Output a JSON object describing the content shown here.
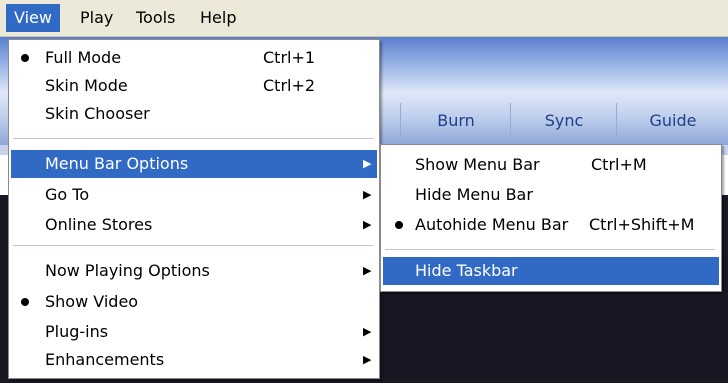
{
  "menubar": {
    "items": [
      {
        "label": "View"
      },
      {
        "label": "Play"
      },
      {
        "label": "Tools"
      },
      {
        "label": "Help"
      }
    ]
  },
  "background_tabs": [
    {
      "label": "Burn"
    },
    {
      "label": "Sync"
    },
    {
      "label": "Guide"
    }
  ],
  "view_menu": {
    "items": [
      {
        "label": "Full Mode",
        "shortcut": "Ctrl+1"
      },
      {
        "label": "Skin Mode",
        "shortcut": "Ctrl+2"
      },
      {
        "label": "Skin Chooser"
      },
      {
        "label": "Menu Bar Options"
      },
      {
        "label": "Go To"
      },
      {
        "label": "Online Stores"
      },
      {
        "label": "Now Playing Options"
      },
      {
        "label": "Show Video"
      },
      {
        "label": "Plug-ins"
      },
      {
        "label": "Enhancements"
      }
    ]
  },
  "submenu": {
    "items": [
      {
        "label": "Show Menu Bar",
        "shortcut": "Ctrl+M"
      },
      {
        "label": "Hide Menu Bar"
      },
      {
        "label": "Autohide Menu Bar",
        "shortcut": "Ctrl+Shift+M"
      },
      {
        "label": "Hide Taskbar"
      }
    ]
  },
  "colors": {
    "highlight": "#316ac5",
    "menubar": "#ece9d8",
    "app_dark": "#1a1623"
  }
}
